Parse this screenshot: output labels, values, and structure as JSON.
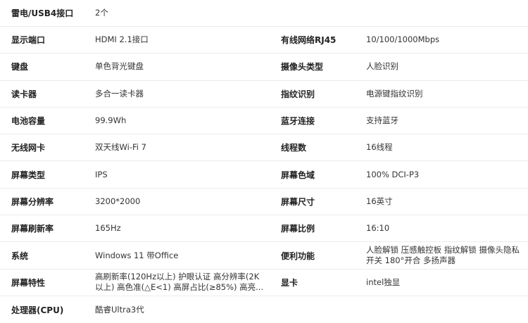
{
  "specs": {
    "rows": [
      {
        "left_label": "雷电/USB4接口",
        "left_value": "2个",
        "right_label": "",
        "right_value": ""
      },
      {
        "left_label": "显示端口",
        "left_value": "HDMI 2.1接口",
        "right_label": "有线网络RJ45",
        "right_value": "10/100/1000Mbps"
      },
      {
        "left_label": "键盘",
        "left_value": "单色背光键盘",
        "right_label": "摄像头类型",
        "right_value": "人脸识别"
      },
      {
        "left_label": "读卡器",
        "left_value": "多合一读卡器",
        "right_label": "指纹识别",
        "right_value": "电源键指纹识别"
      },
      {
        "left_label": "电池容量",
        "left_value": "99.9Wh",
        "right_label": "蓝牙连接",
        "right_value": "支持蓝牙"
      },
      {
        "left_label": "无线网卡",
        "left_value": "双天线Wi-Fi 7",
        "right_label": "线程数",
        "right_value": "16线程"
      },
      {
        "left_label": "屏幕类型",
        "left_value": "IPS",
        "right_label": "屏幕色域",
        "right_value": "100% DCI-P3"
      },
      {
        "left_label": "屏幕分辨率",
        "left_value": "3200*2000",
        "right_label": "屏幕尺寸",
        "right_value": "16英寸"
      },
      {
        "left_label": "屏幕刷新率",
        "left_value": "165Hz",
        "right_label": "屏幕比例",
        "right_value": "16:10"
      },
      {
        "left_label": "系统",
        "left_value": "Windows 11 带Office",
        "right_label": "便利功能",
        "right_value": "人脸解锁 压感触控板 指纹解锁 摄像头隐私开关 180°开合 多扬声器"
      },
      {
        "left_label": "屏幕特性",
        "left_value": "高刷新率(120Hz以上) 护眼认证 高分辨率(2K以上) 高色准(△E<1) 高屏占比(≥85%) 高亮...",
        "right_label": "显卡",
        "right_value": "intel独显"
      },
      {
        "left_label": "处理器(CPU)",
        "left_value": "酷睿Ultra3代",
        "right_label": "",
        "right_value": ""
      }
    ]
  }
}
